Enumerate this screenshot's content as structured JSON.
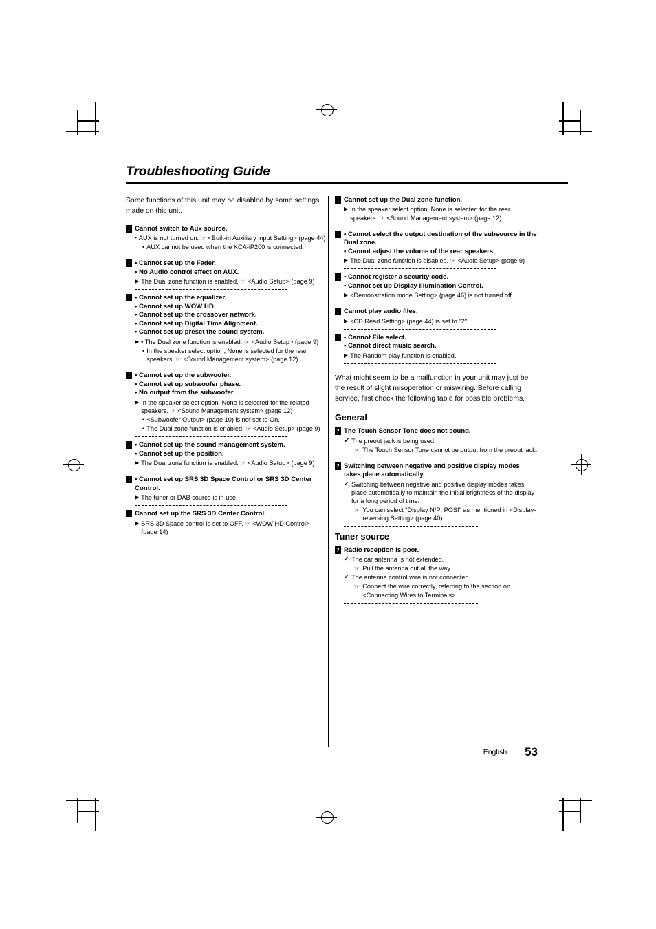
{
  "title": "Troubleshooting Guide",
  "intro_left": "Some functions of this unit may be disabled by some settings made on this unit.",
  "intro_right": "What might seem to be a malfunction in your unit may just be the result of slight misoperation or miswiring. Before calling service, first check the following table for possible problems.",
  "footer": {
    "language": "English",
    "page": "53"
  },
  "badges": {
    "warn": "!",
    "quest": "?"
  },
  "marks": {
    "arrow": "▶",
    "bullet": "•",
    "check": "✔",
    "hand": "☞"
  },
  "left_entries": [
    {
      "badge": "!",
      "heads": [
        "Cannot switch to Aux source."
      ],
      "lines": [
        {
          "type": "cause",
          "mark": "bullet",
          "text": "AUX is not turned on. ☞ <Built-in Auxiliary input Setting> (page 44)"
        },
        {
          "type": "bullet",
          "mark": "bullet",
          "text": "AUX cannot be used when the KCA-iP200 is connected."
        }
      ]
    },
    {
      "badge": "!",
      "heads": [
        "• Cannot set up the Fader.",
        "• No Audio control effect on AUX."
      ],
      "lines": [
        {
          "type": "cause",
          "mark": "arrow",
          "text": "The Dual zone function is enabled. ☞ <Audio Setup> (page 9)"
        }
      ]
    },
    {
      "badge": "!",
      "heads": [
        "• Cannot set up the equalizer.",
        "• Cannot set up WOW HD.",
        "• Cannot set up the crossover network.",
        "• Cannot set up Digital Time Alignment.",
        "• Cannot set up preset the sound system."
      ],
      "lines": [
        {
          "type": "cause",
          "mark": "arrow",
          "text": "• The Dual zone function is enabled. ☞ <Audio Setup> (page 9)"
        },
        {
          "type": "bullet",
          "mark": "bullet",
          "text": "In the speaker select option, None is selected for the rear speakers. ☞ <Sound Management system> (page 12)"
        }
      ]
    },
    {
      "badge": "!",
      "heads": [
        "• Cannot set up the subwoofer.",
        "• Cannot set up subwoofer phase.",
        "• No output from the subwoofer."
      ],
      "lines": [
        {
          "type": "cause",
          "mark": "arrow",
          "text": "In the speaker select option, None is selected for the related speakers. ☞ <Sound Management system> (page 12)"
        },
        {
          "type": "bullet",
          "mark": "bullet",
          "text": "<Subwoofer Output> (page 10) is not set to On."
        },
        {
          "type": "bullet",
          "mark": "bullet",
          "text": "The Dual zone function is enabled. ☞ <Audio Setup> (page 9)"
        }
      ]
    },
    {
      "badge": "!",
      "heads": [
        "• Cannot set up the sound management system.",
        "• Cannot set up the position."
      ],
      "lines": [
        {
          "type": "cause",
          "mark": "arrow",
          "text": "The Dual zone function is enabled. ☞ <Audio Setup> (page 9)"
        }
      ]
    },
    {
      "badge": "!",
      "heads": [
        "• Cannot set up SRS 3D Space Control or SRS 3D Center Control."
      ],
      "lines": [
        {
          "type": "cause",
          "mark": "arrow",
          "text": "The tuner or DAB source is in use."
        }
      ]
    },
    {
      "badge": "!",
      "heads": [
        "Cannot set up the SRS 3D Center Control."
      ],
      "lines": [
        {
          "type": "cause",
          "mark": "arrow",
          "text": "SRS 3D Space control is set to OFF. ☞ <WOW HD Control> (page 14)"
        }
      ]
    }
  ],
  "right_entries": [
    {
      "badge": "!",
      "heads": [
        "Cannot set up the Dual zone function."
      ],
      "lines": [
        {
          "type": "cause",
          "mark": "arrow",
          "text": "In the speaker select option, None is selected for the rear speakers. ☞ <Sound Management system> (page 12)"
        }
      ]
    },
    {
      "badge": "!",
      "heads": [
        "• Cannot select the output destination of the subsource in the Dual zone.",
        "• Cannot adjust the volume of the rear speakers."
      ],
      "lines": [
        {
          "type": "cause",
          "mark": "arrow",
          "text": "The Dual zone function is disabled. ☞ <Audio Setup> (page 9)"
        }
      ]
    },
    {
      "badge": "!",
      "heads": [
        "• Cannot register a security code.",
        "• Cannot set up Display Illumination Control."
      ],
      "lines": [
        {
          "type": "cause",
          "mark": "arrow",
          "text": "<Demonstration mode Setting> (page 46) is not turned off."
        }
      ]
    },
    {
      "badge": "!",
      "heads": [
        "Cannot play audio files."
      ],
      "lines": [
        {
          "type": "cause",
          "mark": "arrow",
          "text": "<CD Read Setting> (page 44) is set to \"2\"."
        }
      ]
    },
    {
      "badge": "!",
      "heads": [
        "• Cannot File select.",
        "• Cannot direct music search."
      ],
      "lines": [
        {
          "type": "cause",
          "mark": "arrow",
          "text": "The Random play function is enabled."
        }
      ]
    }
  ],
  "sections": [
    {
      "heading": "General",
      "entries": [
        {
          "badge": "?",
          "heads": [
            "The Touch Sensor Tone does not sound."
          ],
          "lines": [
            {
              "type": "cause",
              "mark": "check",
              "text": "The preout jack is being used."
            },
            {
              "type": "action",
              "mark": "hand",
              "text": "The Touch Sensor Tone cannot be output from the preout jack."
            }
          ]
        },
        {
          "badge": "?",
          "heads": [
            "Switching between negative and positive display modes takes place automatically."
          ],
          "lines": [
            {
              "type": "cause",
              "mark": "check",
              "text": "Switching between negative and positive display modes takes place automatically to maintain the initial brightness of the display for a long period of time."
            },
            {
              "type": "action",
              "mark": "hand",
              "text": "You can select \"Display N/P: POSI\" as mentioned in <Display-reversing Setting> (page 40)."
            }
          ]
        }
      ]
    },
    {
      "heading": "Tuner source",
      "entries": [
        {
          "badge": "?",
          "heads": [
            "Radio reception is poor."
          ],
          "lines": [
            {
              "type": "cause",
              "mark": "check",
              "text": "The car antenna is not extended."
            },
            {
              "type": "action",
              "mark": "hand",
              "text": "Pull the antenna out all the way."
            },
            {
              "type": "cause",
              "mark": "check",
              "text": "The antenna control wire is not connected."
            },
            {
              "type": "action",
              "mark": "hand",
              "text": "Connect the wire correctly, referring to the section on <Connecting Wires to Terminals>."
            }
          ]
        }
      ]
    }
  ]
}
